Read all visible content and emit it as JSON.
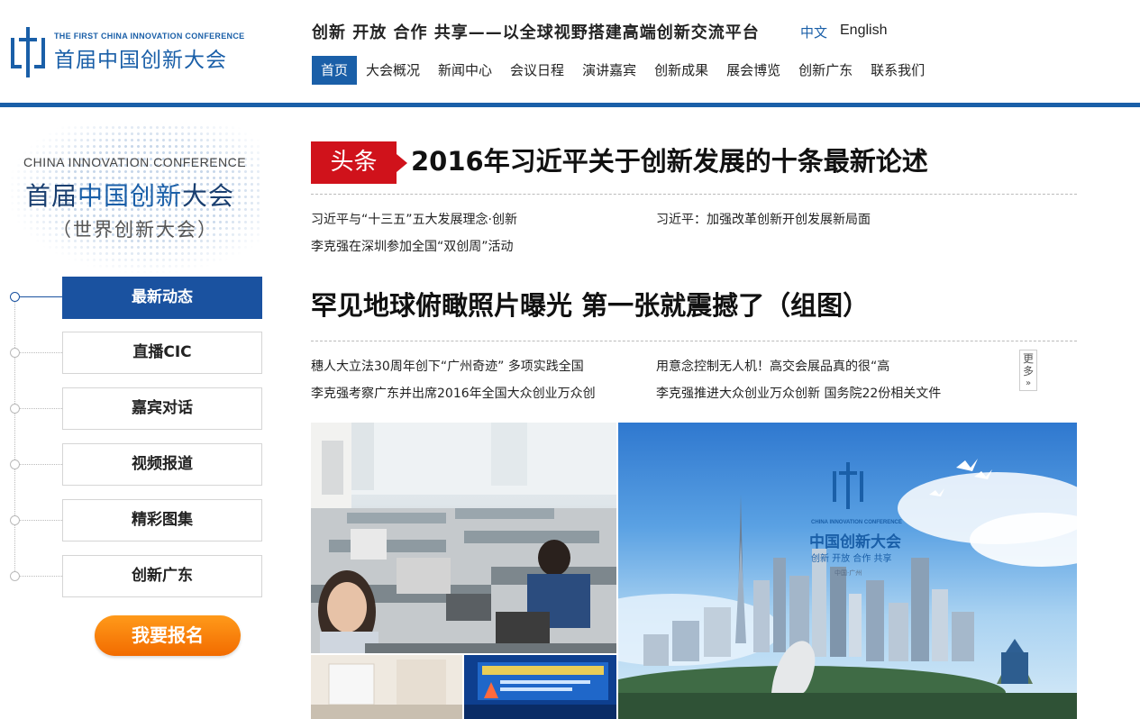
{
  "header": {
    "logo_en": "THE FIRST CHINA INNOVATION CONFERENCE",
    "logo_cn": "首届中国创新大会",
    "slogan": "创新 开放 合作 共享——以全球视野搭建高端创新交流平台",
    "lang_cn": "中文",
    "lang_en": "English"
  },
  "nav": [
    "首页",
    "大会概况",
    "新闻中心",
    "会议日程",
    "演讲嘉宾",
    "创新成果",
    "展会博览",
    "创新广东",
    "联系我们"
  ],
  "sidebar": {
    "banner_en": "CHINA INNOVATION CONFERENCE",
    "banner_cn_a": "首届",
    "banner_cn_b": "中国创新",
    "banner_cn_c": "大会",
    "banner_sub": "（世界创新大会）",
    "menu": [
      "最新动态",
      "直播CIC",
      "嘉宾对话",
      "视频报道",
      "精彩图集",
      "创新广东"
    ],
    "signup": "我要报名"
  },
  "main": {
    "headline_tag": "头条",
    "headline_title": "2016年习近平关于创新发展的十条最新论述",
    "headline_links": [
      "习近平与“十三五”五大发展理念·创新",
      "习近平：加强改革创新开创发展新局面",
      "李克强在深圳参加全国“双创周”活动"
    ],
    "title2": "罕见地球俯瞰照片曝光 第一张就震撼了（组图）",
    "links2": [
      "穗人大立法30周年创下“广州奇迹” 多项实践全国",
      "用意念控制无人机！高交会展品真的很“高",
      "李克强考察广东并出席2016年全国大众创业万众创",
      "李克强推进大众创业万众创新 国务院22份相关文件"
    ],
    "more": "更多",
    "photo_city_en": "CHINA INNOVATION CONFERENCE",
    "photo_city_cn": "中国创新大会",
    "photo_city_motto": "创新 开放 合作 共享",
    "photo_city_place": "中国·广州"
  }
}
